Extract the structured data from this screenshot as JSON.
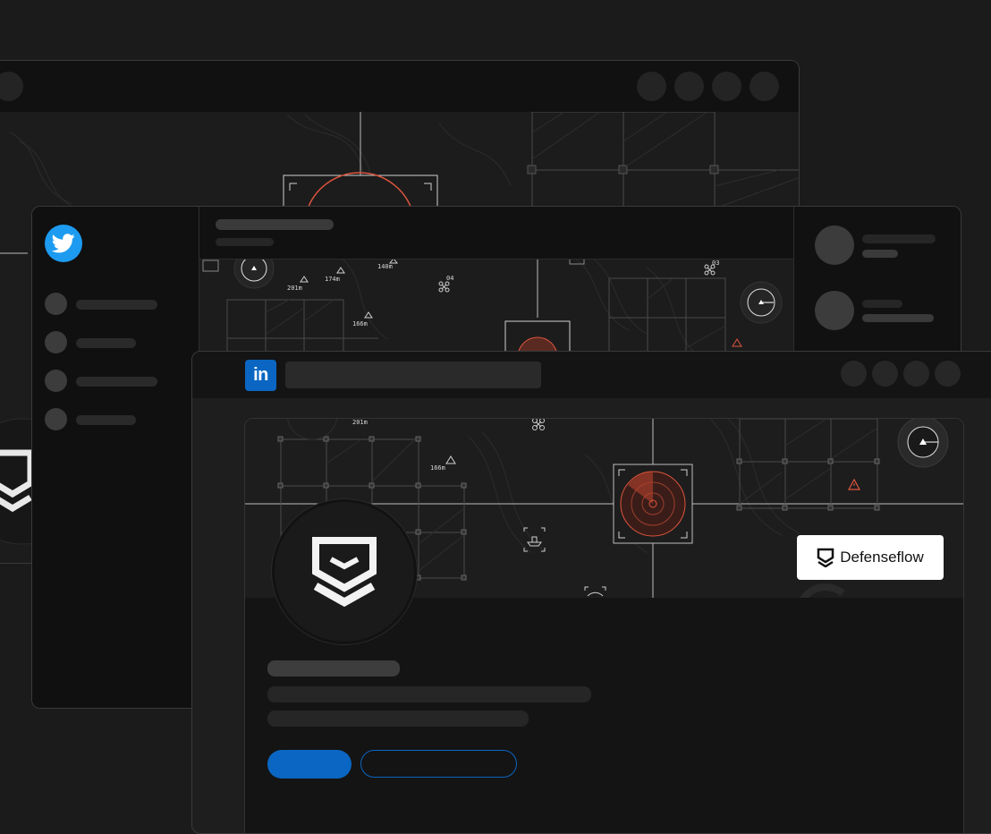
{
  "linkedin": {
    "logo_text": "in",
    "company_badge": {
      "name": "Defenseflow",
      "icon": "shield-chevron-icon"
    },
    "map_labels": [
      "201m",
      "166m"
    ]
  },
  "twitter": {
    "logo_icon": "twitter-bird-icon",
    "map_labels": [
      "201m",
      "174m",
      "140m",
      "166m",
      "04",
      "03"
    ]
  },
  "colors": {
    "twitter_blue": "#1d9bf0",
    "linkedin_blue": "#0a66c2",
    "radar_red": "#e0553e",
    "background": "#1b1b1b"
  }
}
